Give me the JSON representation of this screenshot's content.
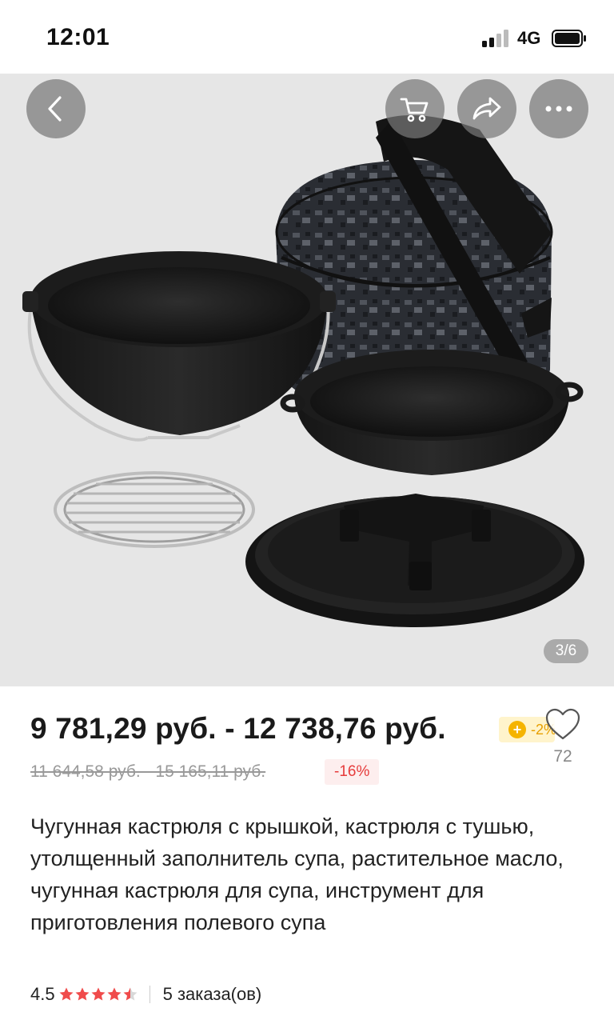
{
  "status_bar": {
    "time": "12:01",
    "network": "4G"
  },
  "gallery": {
    "page_counter": "3/6",
    "icons": [
      "back-arrow-icon",
      "cart-icon",
      "share-icon",
      "more-icon"
    ]
  },
  "product": {
    "price_range": "9 781,29 руб. - 12 738,76 руб.",
    "coin_discount": "-2%",
    "old_price_range": "11 644,58 руб. - 15 165,11 руб.",
    "discount": "-16%",
    "wishlist_count": "72",
    "title": "Чугунная кастрюля с крышкой, кастрюля с тушью, утолщенный заполнитель супа, растительное масло, чугунная кастрюля для супа, инструмент для приготовления полевого супа",
    "rating": "4.5",
    "rating_stars": 4.5,
    "orders": "5 заказа(ов)"
  },
  "colors": {
    "accent_red": "#e63b3b",
    "star_red": "#f04b4b",
    "coin_gold": "#f5b400"
  }
}
